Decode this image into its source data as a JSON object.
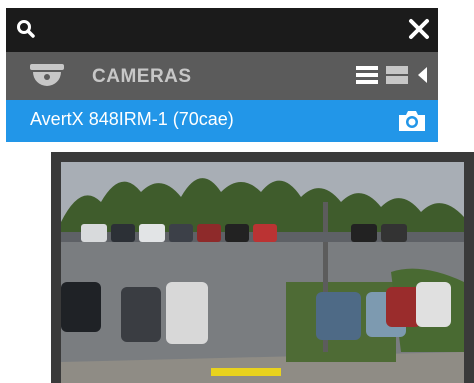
{
  "search": {
    "icon": "search-icon",
    "close_icon": "close-icon"
  },
  "header": {
    "title": "CAMERAS",
    "icon": "dome-camera-icon",
    "tools": [
      "list-view-icon",
      "grid-view-icon",
      "collapse-arrow-icon"
    ]
  },
  "camera": {
    "name": "AvertX 848IRM-1 (70cae)",
    "snapshot_icon": "snapshot-camera-icon"
  },
  "colors": {
    "search_bg": "#1b1b1b",
    "header_bg": "#5b5b5b",
    "row_accent": "#2296e8",
    "title_text": "#c7c7c7"
  }
}
